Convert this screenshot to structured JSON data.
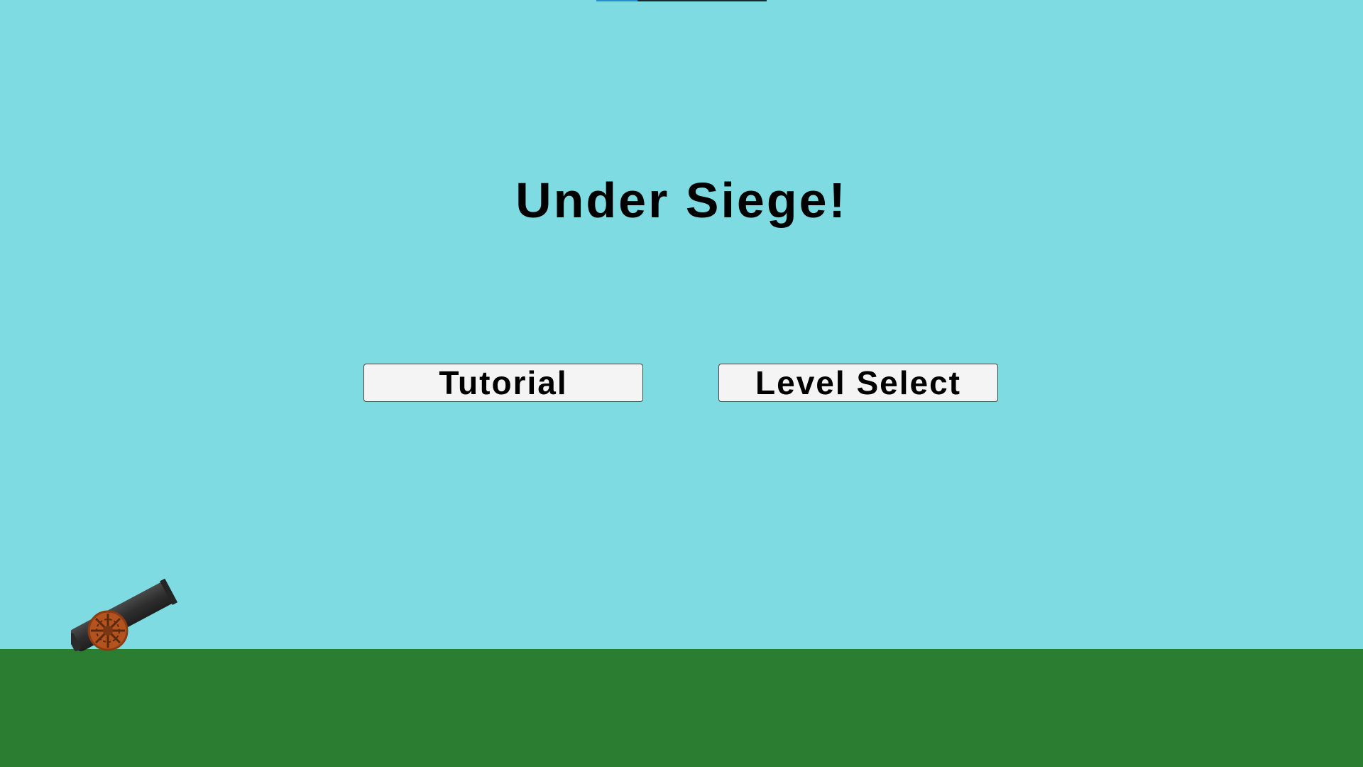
{
  "game": {
    "title": "Under Siege!"
  },
  "menu": {
    "tutorial_label": "Tutorial",
    "level_select_label": "Level Select"
  },
  "loading": {
    "progress": 0.24
  },
  "colors": {
    "sky": "#7DDBE1",
    "ground": "#2A7D31",
    "button_bg": "#F4F4F4",
    "loading_fill": "#2A8BD8",
    "loading_track": "#1A2A33",
    "cannon_barrel": "#3A3A3A",
    "cannon_wheel": "#B5531E"
  },
  "icons": {
    "cannon": "cannon-icon"
  }
}
